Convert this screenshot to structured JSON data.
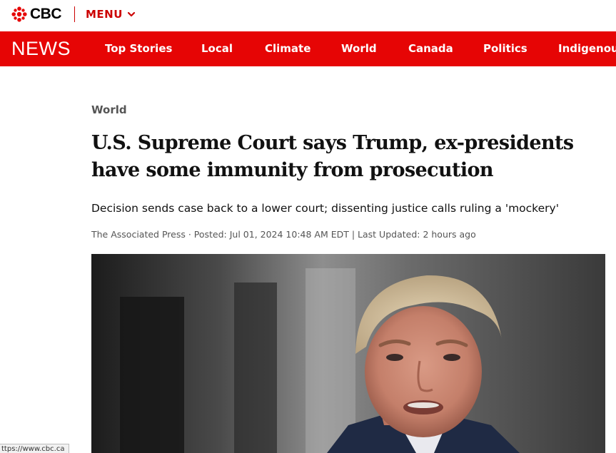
{
  "brand": {
    "logo_text": "CBC",
    "menu_label": "MENU"
  },
  "newsbar": {
    "title": "NEWS",
    "nav": [
      {
        "label": "Top Stories"
      },
      {
        "label": "Local"
      },
      {
        "label": "Climate"
      },
      {
        "label": "World"
      },
      {
        "label": "Canada"
      },
      {
        "label": "Politics"
      },
      {
        "label": "Indigenous"
      }
    ]
  },
  "article": {
    "section": "World",
    "headline": "U.S. Supreme Court says Trump, ex-presidents have some immunity from prosecution",
    "dek": "Decision sends case back to a lower court; dissenting justice calls ruling a 'mockery'",
    "byline": "The Associated Press · Posted: Jul 01, 2024 10:48 AM EDT | Last Updated: 2 hours ago"
  },
  "status_url": "ttps://www.cbc.ca",
  "colors": {
    "brand_red": "#e60505",
    "menu_red": "#cc0000"
  }
}
